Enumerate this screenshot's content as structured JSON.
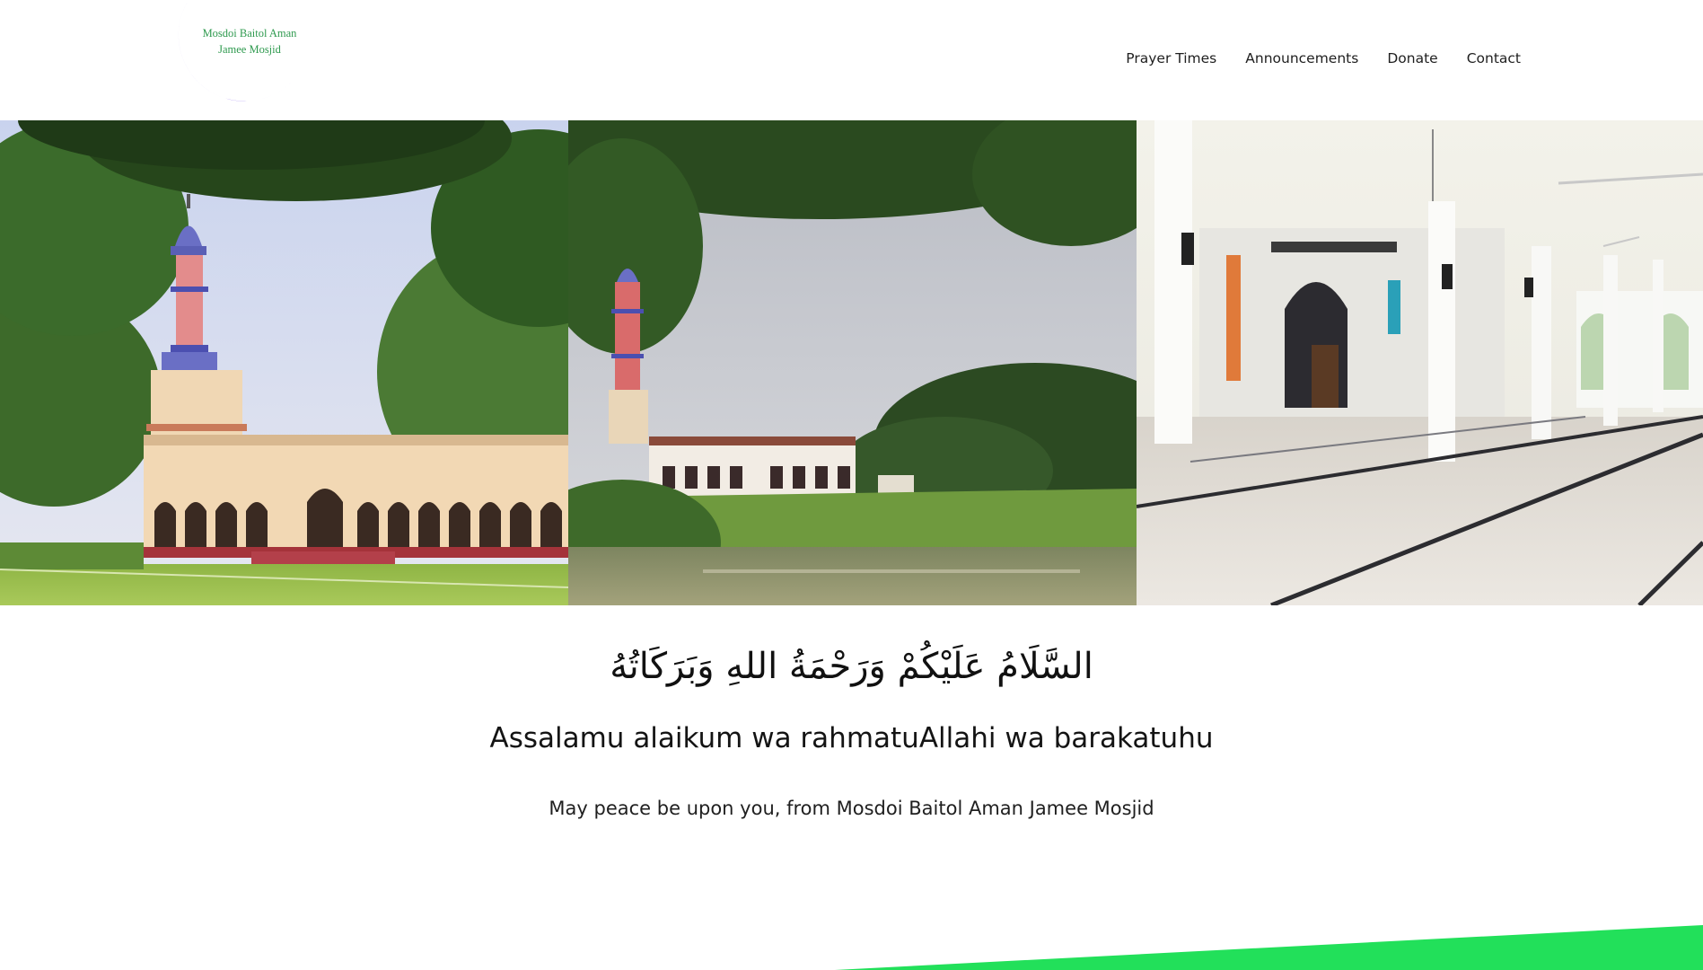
{
  "header": {
    "logo": {
      "line1": "Mosdoi Baitol Aman",
      "line2": "Jamee Mosjid",
      "crescent_color": "#4a14e6",
      "text_color": "#2f9a4f"
    },
    "nav": [
      {
        "label": "Prayer Times"
      },
      {
        "label": "Announcements"
      },
      {
        "label": "Donate"
      },
      {
        "label": "Contact"
      }
    ]
  },
  "gallery": {
    "images": [
      {
        "name": "mosque-exterior-with-minaret"
      },
      {
        "name": "mosque-beside-pond"
      },
      {
        "name": "mosque-prayer-hall-interior"
      }
    ]
  },
  "greeting": {
    "arabic": "السَّلَامُ عَلَيْكُمْ وَرَحْمَةُ اللهِ وَبَرَكَاتُهُ",
    "heading": "Assalamu alaikum wa rahmatuAllahi wa barakatuhu",
    "subtitle": "May peace be upon you, from Mosdoi Baitol Aman Jamee Mosjid"
  },
  "colors": {
    "accent_green": "#22e05a",
    "nav_text": "#1f1f1f",
    "background": "#ffffff"
  }
}
